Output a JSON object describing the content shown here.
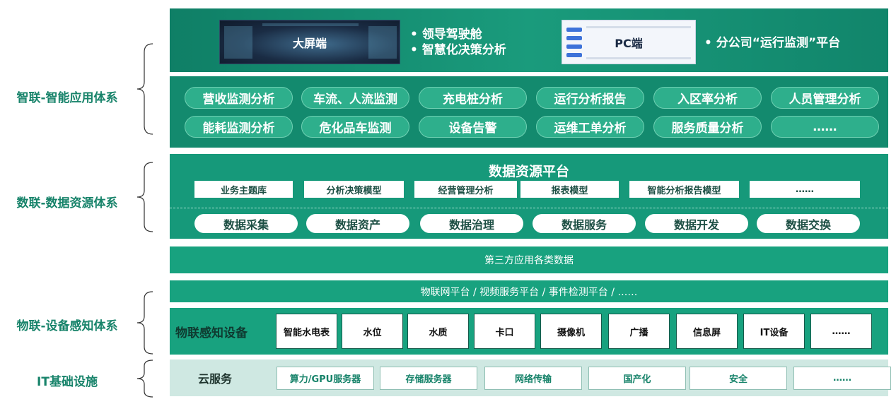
{
  "side_labels": {
    "app": "智联-智能应用体系",
    "data": "数联-数据资源体系",
    "iot": "物联-设备感知体系",
    "it": "IT基础设施"
  },
  "top": {
    "big_screen_label": "大屏端",
    "big_bullets": [
      "• 领导驾驶舱",
      "• 智慧化决策分析"
    ],
    "pc_label": "PC端",
    "pc_bullet": "• 分公司“运行监测”平台"
  },
  "capabilities": [
    "营收监测分析",
    "车流、人流监测",
    "充电桩分析",
    "运行分析报告",
    "入区率分析",
    "人员管理分析",
    "能耗监测分析",
    "危化品车监测",
    "设备告警",
    "运维工单分析",
    "服务质量分析",
    "……"
  ],
  "data_platform": {
    "title": "数据资源平台",
    "models": [
      "业务主题库",
      "分析决策模型",
      "经营管理分析",
      "报表模型",
      "智能分析报告模型",
      "……"
    ],
    "functions": [
      "数据采集",
      "数据资产",
      "数据治理",
      "数据服务",
      "数据开发",
      "数据交换"
    ]
  },
  "third_party": "第三方应用各类数据",
  "iot_platform": "物联网平台 / 视频服务平台 / 事件检测平台 / ……",
  "iot_devices": {
    "title": "物联感知设备",
    "items": [
      "智能水电表",
      "水位",
      "水质",
      "卡口",
      "摄像机",
      "广播",
      "信息屏",
      "IT设备",
      "……"
    ]
  },
  "cloud": {
    "title": "云服务",
    "items": [
      "算力/GPU服务器",
      "存储服务器",
      "网络传输",
      "国产化",
      "安全",
      "……"
    ]
  },
  "colors": {
    "accent": "#17836a",
    "layer_dark": "#138a6e",
    "layer_mid": "#18a27f",
    "cloud_bg": "#cfe8e2"
  }
}
